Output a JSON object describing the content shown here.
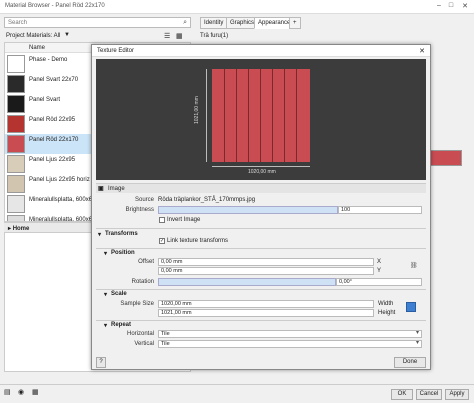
{
  "window": {
    "title": "Material Browser - Panel Röd 22x170"
  },
  "search": {
    "placeholder": "Search"
  },
  "project_bar": {
    "label": "Project Materials: All"
  },
  "list_header": {
    "name": "Name"
  },
  "materials": [
    {
      "label": "Phase - Demo",
      "color": "#ffffff"
    },
    {
      "label": "Panel Svart 22x70",
      "color": "#2a2a2a"
    },
    {
      "label": "Panel Svart",
      "color": "#1a1a1a"
    },
    {
      "label": "Panel Röd 22x95",
      "color": "#b5342f"
    },
    {
      "label": "Panel Röd 22x170",
      "color": "#c94c53"
    },
    {
      "label": "Panel Ljus 22x95",
      "color": "#d8cdb8"
    },
    {
      "label": "Panel Ljus 22x95 horiz",
      "color": "#d1c5b0"
    },
    {
      "label": "Mineralullsplatta, 600x600, v",
      "color": "#e6e6e6"
    },
    {
      "label": "Mineralullsplatta, 600x600, v",
      "color": "#dddddd"
    }
  ],
  "tree": {
    "home": "Home"
  },
  "tabs": [
    "Identity",
    "Graphics",
    "Appearance",
    "+"
  ],
  "right": {
    "subtitle": "Trä furu(1)"
  },
  "dialog": {
    "title": "Texture Editor",
    "dim_width": "1020,00 mm",
    "dim_height": "1021,00 mm",
    "image_section": "Image",
    "source_label": "Source",
    "source_value": "Röda träplankor_STÅ_170mmps.jpg",
    "brightness_label": "Brightness",
    "brightness_value": "100",
    "invert_label": "Invert Image",
    "transforms_section": "Transforms",
    "link_label": "Link texture transforms",
    "position_section": "Position",
    "offset_label": "Offset",
    "offset_x": "0,00 mm",
    "offset_y": "0,00 mm",
    "x": "X",
    "y": "Y",
    "rotation_label": "Rotation",
    "rotation_value": "0,00°",
    "scale_section": "Scale",
    "sample_label": "Sample Size",
    "sample_w": "1020,00 mm",
    "sample_h": "1021,00 mm",
    "width_label": "Width",
    "height_label": "Height",
    "repeat_section": "Repeat",
    "horizontal_label": "Horizontal",
    "horizontal_value": "Tile",
    "vertical_label": "Vertical",
    "vertical_value": "Tile",
    "help": "?",
    "done": "Done"
  },
  "footer": {
    "ok": "OK",
    "cancel": "Cancel",
    "apply": "Apply"
  },
  "colors": {
    "texture": "#c94c53",
    "preview_bg": "#3c3c3c",
    "selection": "#cce4f7"
  }
}
